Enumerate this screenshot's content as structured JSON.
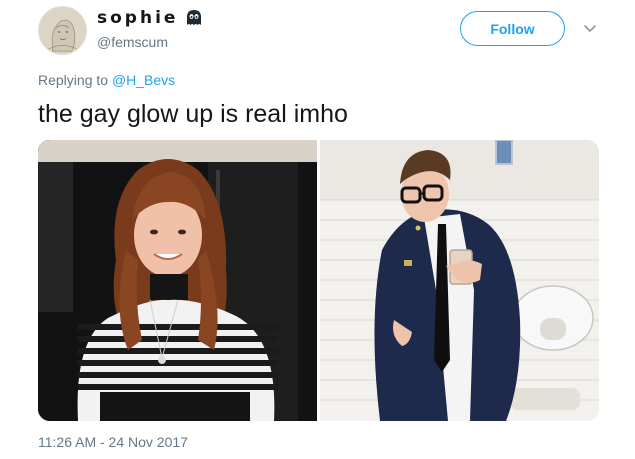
{
  "user": {
    "display_name": "sophie",
    "handle": "@femscum",
    "name_icon": "ghost-face-emoji",
    "avatar": "avatar-image"
  },
  "follow_label": "Follow",
  "caret_icon": "chevron-down-icon",
  "reply": {
    "prefix": "Replying to ",
    "mention": "@H_Bevs"
  },
  "tweet_text": "the gay glow up is real imho",
  "media": [
    {
      "name": "before-photo"
    },
    {
      "name": "after-photo"
    }
  ],
  "timestamp": "11:26 AM - 24 Nov 2017",
  "colors": {
    "accent": "#1da1f2",
    "secondary_text": "#657786",
    "primary_text": "#14171a"
  }
}
